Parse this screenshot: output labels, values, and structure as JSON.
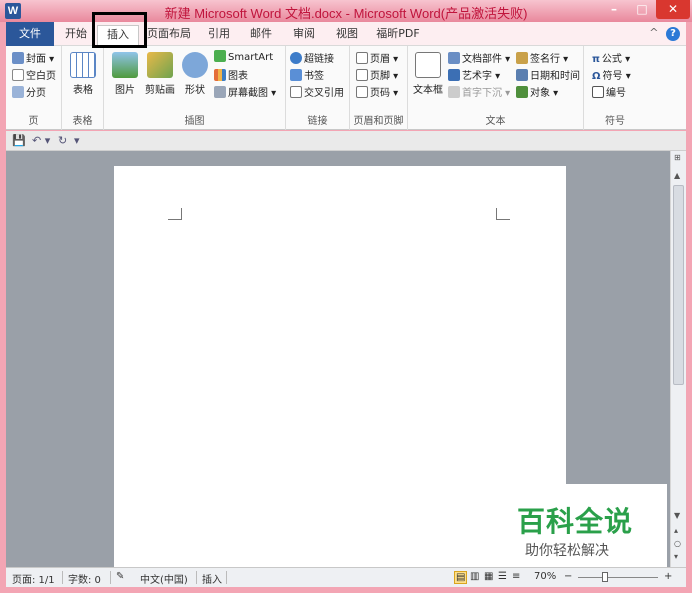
{
  "window": {
    "title": "新建 Microsoft Word 文档.docx - Microsoft Word(产品激活失败)",
    "app_icon_letter": "W",
    "minimize": "–",
    "maximize": "□",
    "close": "✕"
  },
  "tabs": [
    {
      "label": "文件"
    },
    {
      "label": "开始"
    },
    {
      "label": "插入"
    },
    {
      "label": "页面布局"
    },
    {
      "label": "引用"
    },
    {
      "label": "邮件"
    },
    {
      "label": "审阅"
    },
    {
      "label": "视图"
    },
    {
      "label": "福昕PDF"
    }
  ],
  "help": {
    "arrow": "^",
    "icon": "?"
  },
  "ribbon": {
    "pages": {
      "label": "页",
      "items": [
        "封面 ▾",
        "空白页",
        "分页"
      ]
    },
    "table": {
      "label": "表格",
      "button": "表格"
    },
    "illustrations": {
      "label": "插图",
      "picture": "图片",
      "clipart": "剪贴画",
      "shapes": "形状",
      "smartart": "SmartArt",
      "chart": "图表",
      "screenshot": "屏幕截图 ▾"
    },
    "links": {
      "label": "链接",
      "items": [
        "超链接",
        "书签",
        "交叉引用"
      ]
    },
    "header_footer": {
      "label": "页眉和页脚",
      "items": [
        "页眉 ▾",
        "页脚 ▾",
        "页码 ▾"
      ]
    },
    "text": {
      "label": "文本",
      "textbox": "文本框",
      "quickparts": "文档部件 ▾",
      "wordart": "艺术字 ▾",
      "dropcap": "首字下沉 ▾",
      "signature": "签名行 ▾",
      "datetime": "日期和时间",
      "object": "对象 ▾"
    },
    "symbols": {
      "label": "符号",
      "items": [
        "公式 ▾",
        "符号 ▾",
        "编号"
      ]
    }
  },
  "qat": {
    "save": "💾",
    "undo": "↶ ▾",
    "redo": "↻",
    "customize": "▾"
  },
  "status": {
    "page": "页面: 1/1",
    "words": "字数: 0",
    "language": "中文(中国)",
    "mode": "插入",
    "zoom": "70%",
    "zoom_minus": "−",
    "zoom_plus": "+"
  },
  "watermark": {
    "title": "百科全说",
    "subtitle": "助你轻松解决"
  },
  "colors": {
    "file_tab": "#2b579a",
    "watermark_green": "#2aa04a",
    "highlight": "#000000"
  }
}
